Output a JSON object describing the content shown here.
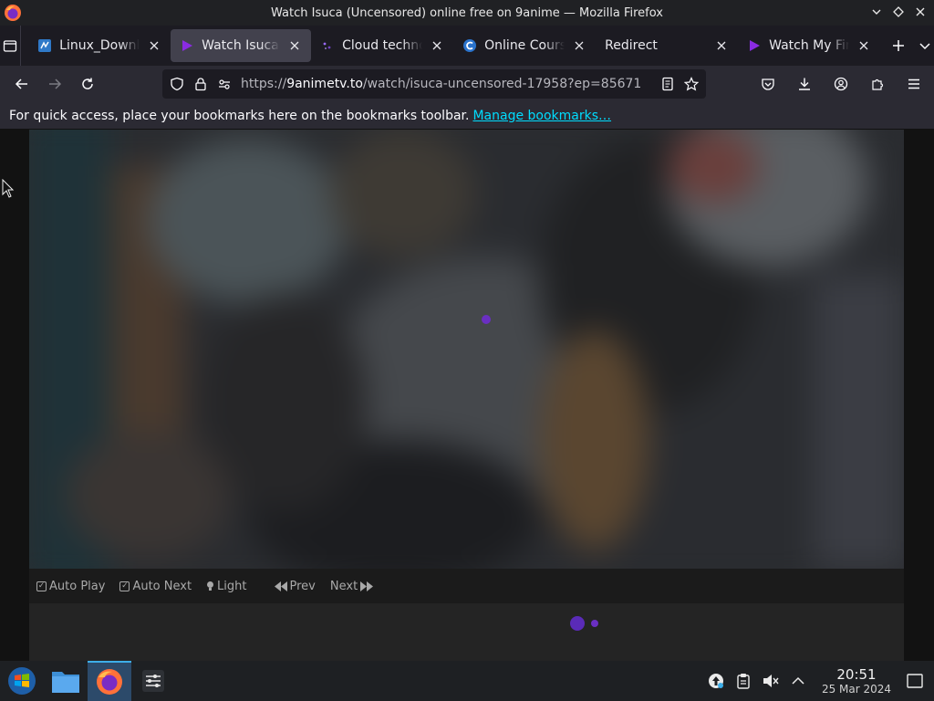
{
  "window": {
    "title": "Watch Isuca (Uncensored) online free on 9anime — Mozilla Firefox"
  },
  "tabs": [
    {
      "title": "Linux_Downlo",
      "favicon": "linux-icon",
      "active": false
    },
    {
      "title": "Watch Isuca (U",
      "favicon": "play-icon",
      "active": true
    },
    {
      "title": "Cloud technol",
      "favicon": "cloud-icon",
      "active": false
    },
    {
      "title": "Online Course",
      "favicon": "coursera-icon",
      "active": false
    },
    {
      "title": "Redirect",
      "favicon": "",
      "active": false
    },
    {
      "title": "Watch My Firs",
      "favicon": "play-icon",
      "active": false
    }
  ],
  "urlbar": {
    "prefix": "https://",
    "domain": "9animetv.to",
    "path": "/watch/isuca-uncensored-17958?ep=85671"
  },
  "bookmarks_bar": {
    "message": "For quick access, place your bookmarks here on the bookmarks toolbar.",
    "link": "Manage bookmarks…"
  },
  "player_controls": {
    "auto_play": "Auto Play",
    "auto_next": "Auto Next",
    "light": "Light",
    "prev": "Prev",
    "next": "Next"
  },
  "taskbar": {
    "time": "20:51",
    "date": "25 Mar 2024"
  },
  "colors": {
    "accent_link": "#00ddff",
    "spinner": "#6a2fc2",
    "tab_active": "#42414d"
  }
}
